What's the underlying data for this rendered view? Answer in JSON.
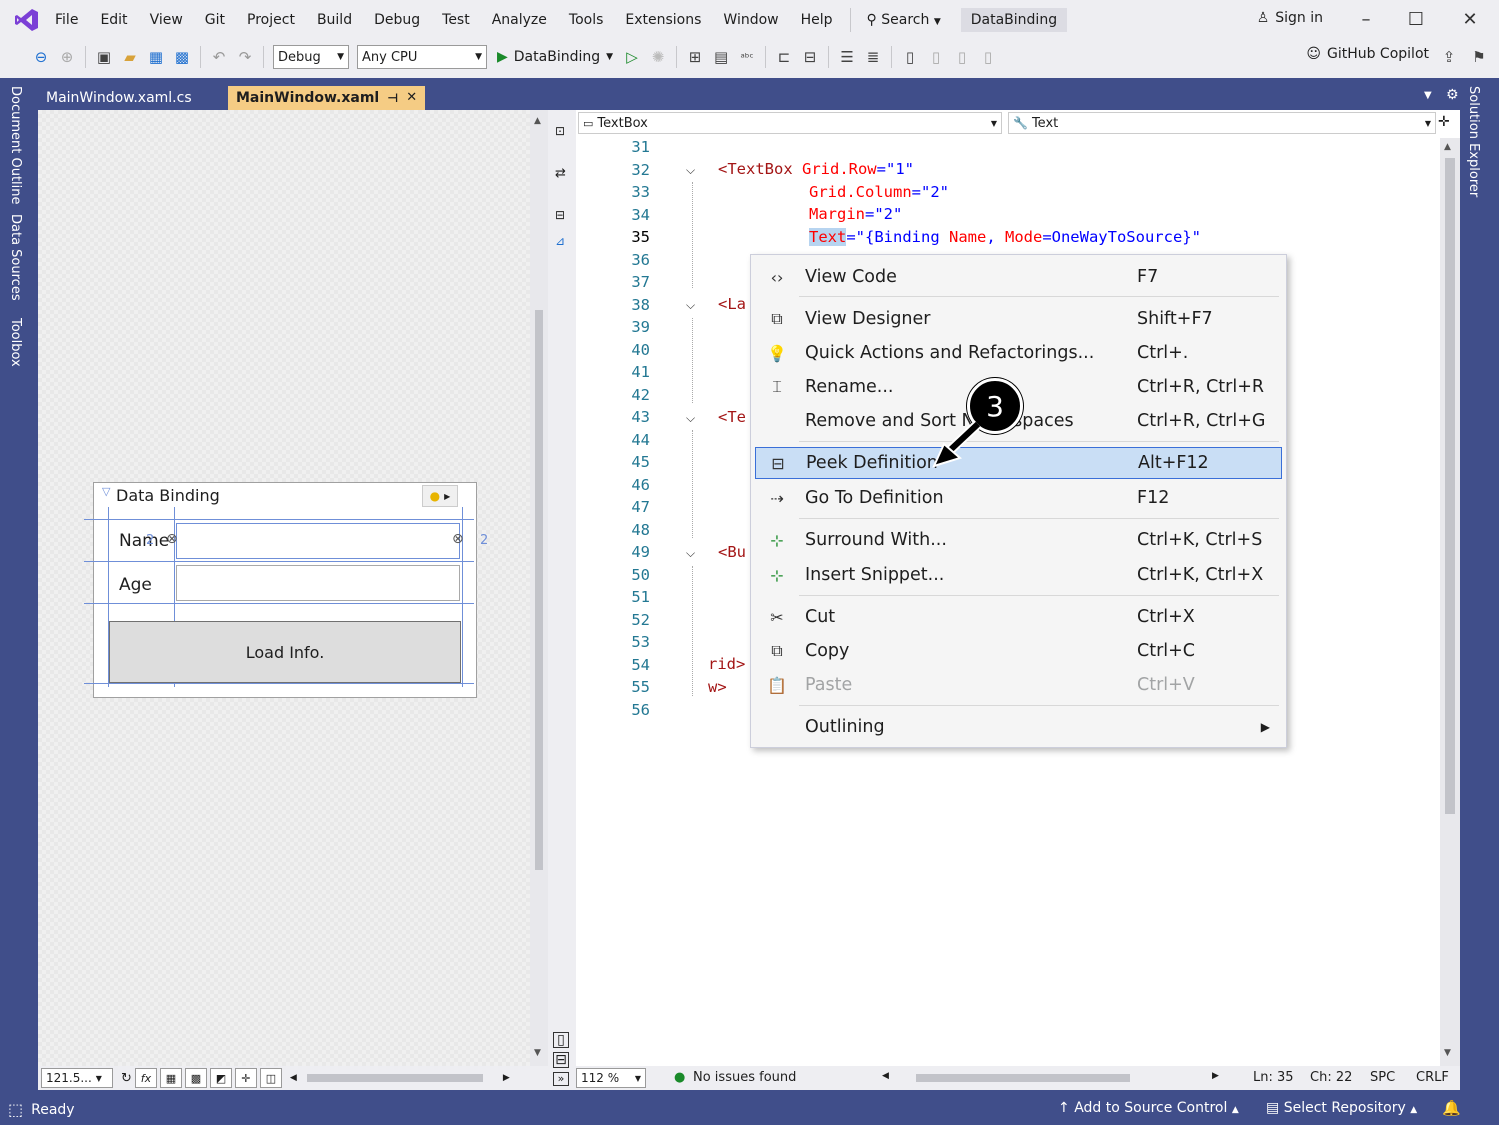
{
  "menu": {
    "items": [
      "File",
      "Edit",
      "View",
      "Git",
      "Project",
      "Build",
      "Debug",
      "Test",
      "Analyze",
      "Tools",
      "Extensions",
      "Window",
      "Help"
    ],
    "search": "Search",
    "solution": "DataBinding",
    "sign_in": "Sign in"
  },
  "toolbar": {
    "config": "Debug",
    "platform": "Any CPU",
    "start_target": "DataBinding",
    "copilot": "GitHub Copilot"
  },
  "left_tabs": [
    "Document Outline",
    "Data Sources",
    "Toolbox"
  ],
  "right_tabs": [
    "Solution Explorer"
  ],
  "doc_tabs": [
    {
      "label": "MainWindow.xaml.cs"
    },
    {
      "label": "MainWindow.xaml"
    }
  ],
  "designer": {
    "window_title": "Data Binding",
    "label_name": "Name",
    "label_age": "Age",
    "button": "Load Info.",
    "zoom": "121.5...",
    "marker_2": "2"
  },
  "editor": {
    "nav_left": "TextBox",
    "nav_right": "Text",
    "zoom": "112 %",
    "issues": "No issues found",
    "ln": "Ln: 35",
    "ch": "Ch: 22",
    "spc": "SPC",
    "crlf": "CRLF",
    "line_numbers": [
      "31",
      "32",
      "33",
      "34",
      "35",
      "36",
      "37",
      "38",
      "39",
      "40",
      "41",
      "42",
      "43",
      "44",
      "45",
      "46",
      "47",
      "48",
      "49",
      "50",
      "51",
      "52",
      "53",
      "54",
      "55",
      "56"
    ],
    "code": {
      "l32_tag": "<TextBox",
      "l32_attr": " Grid.Row",
      "l32_val": "=\"1\"",
      "l33_attr": "Grid.Column",
      "l33_val": "=\"2\"",
      "l34_attr": "Margin",
      "l34_val": "=\"2\"",
      "l35_attr": "Text",
      "l35_val": "=\"{Binding ",
      "l35_name": "Name",
      "l35_comma": ", ",
      "l35_mode": "Mode",
      "l35_val2": "=OneWayToSource}\"",
      "l38": "<La",
      "l43": "<Te",
      "l49": "<Bu",
      "l54": "rid>",
      "l55": "w>"
    }
  },
  "context_menu": {
    "items": [
      {
        "label": "View Code",
        "shortcut": "F7",
        "icon": "code-icon"
      },
      {
        "label": "View Designer",
        "shortcut": "Shift+F7",
        "icon": "designer-icon"
      },
      {
        "label": "Quick Actions and Refactorings...",
        "shortcut": "Ctrl+.",
        "icon": "lightbulb-icon"
      },
      {
        "label": "Rename...",
        "shortcut": "Ctrl+R, Ctrl+R",
        "icon": "rename-icon"
      },
      {
        "label": "Remove and Sort Namespaces",
        "shortcut": "Ctrl+R, Ctrl+G",
        "icon": ""
      },
      {
        "label": "Peek Definition",
        "shortcut": "Alt+F12",
        "icon": "peek-icon"
      },
      {
        "label": "Go To Definition",
        "shortcut": "F12",
        "icon": "goto-icon"
      },
      {
        "label": "Surround With...",
        "shortcut": "Ctrl+K, Ctrl+S",
        "icon": "surround-icon"
      },
      {
        "label": "Insert Snippet...",
        "shortcut": "Ctrl+K, Ctrl+X",
        "icon": "snippet-icon"
      },
      {
        "label": "Cut",
        "shortcut": "Ctrl+X",
        "icon": "cut-icon"
      },
      {
        "label": "Copy",
        "shortcut": "Ctrl+C",
        "icon": "copy-icon"
      },
      {
        "label": "Paste",
        "shortcut": "Ctrl+V",
        "icon": "paste-icon"
      },
      {
        "label": "Outlining",
        "shortcut": "",
        "icon": ""
      }
    ]
  },
  "callout": "3",
  "status": {
    "ready": "Ready",
    "source_control": "Add to Source Control",
    "repository": "Select Repository"
  },
  "colors": {
    "frame": "#404e8a",
    "active_tab": "#f5cc84",
    "selection": "#c9def5",
    "selection_border": "#3a6fd8"
  }
}
